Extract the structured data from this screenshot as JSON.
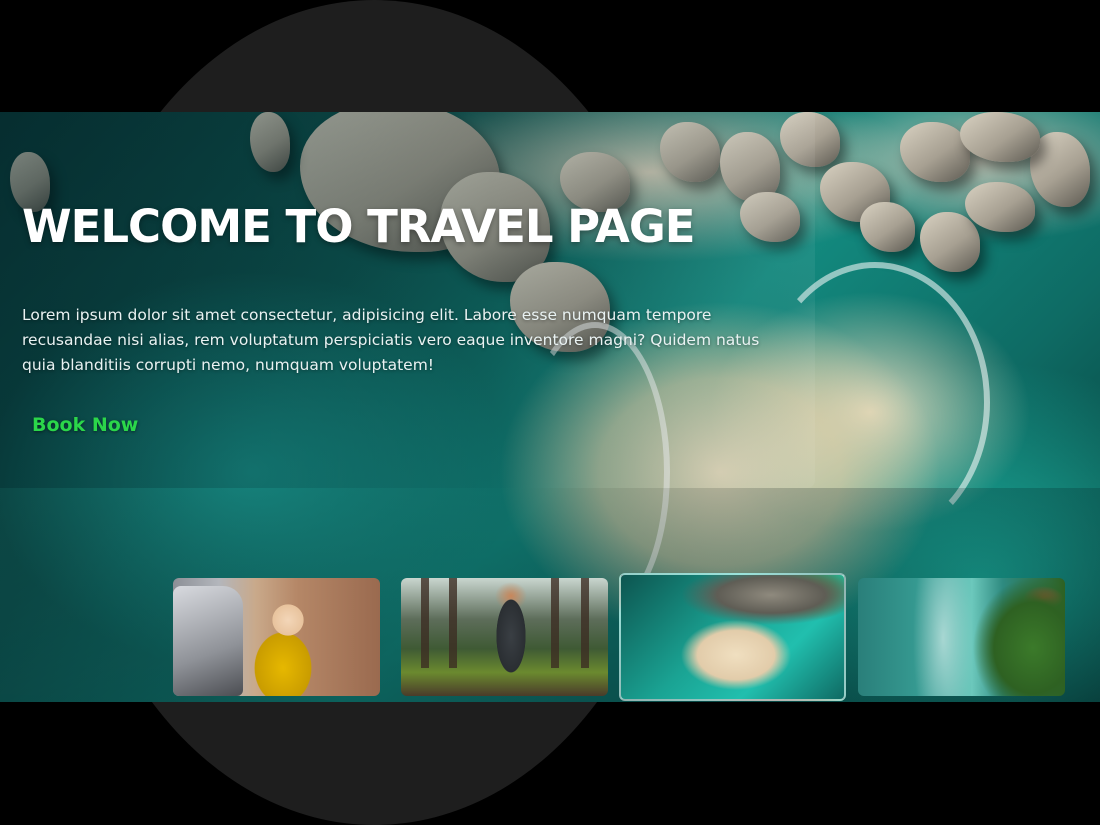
{
  "hero": {
    "title": "WELCOME TO TRAVEL PAGE",
    "paragraph": "Lorem ipsum dolor sit amet consectetur, adipisicing elit. Labore esse numquam tempore recusandae nisi alias, rem voluptatum perspiciatis vero eaque inventore magni? Quidem natus quia blanditiis corrupti nemo, numquam voluptatem!",
    "cta_label": "Book Now",
    "cta_color": "#2bd64a"
  },
  "thumbnails": [
    {
      "subject": "woman leaning out of vehicle in forest",
      "active": false
    },
    {
      "subject": "hiker walking through forest",
      "active": false
    },
    {
      "subject": "aerial beach with rocks and turquoise water",
      "active": true
    },
    {
      "subject": "aerial coastline with green hills",
      "active": false
    }
  ]
}
